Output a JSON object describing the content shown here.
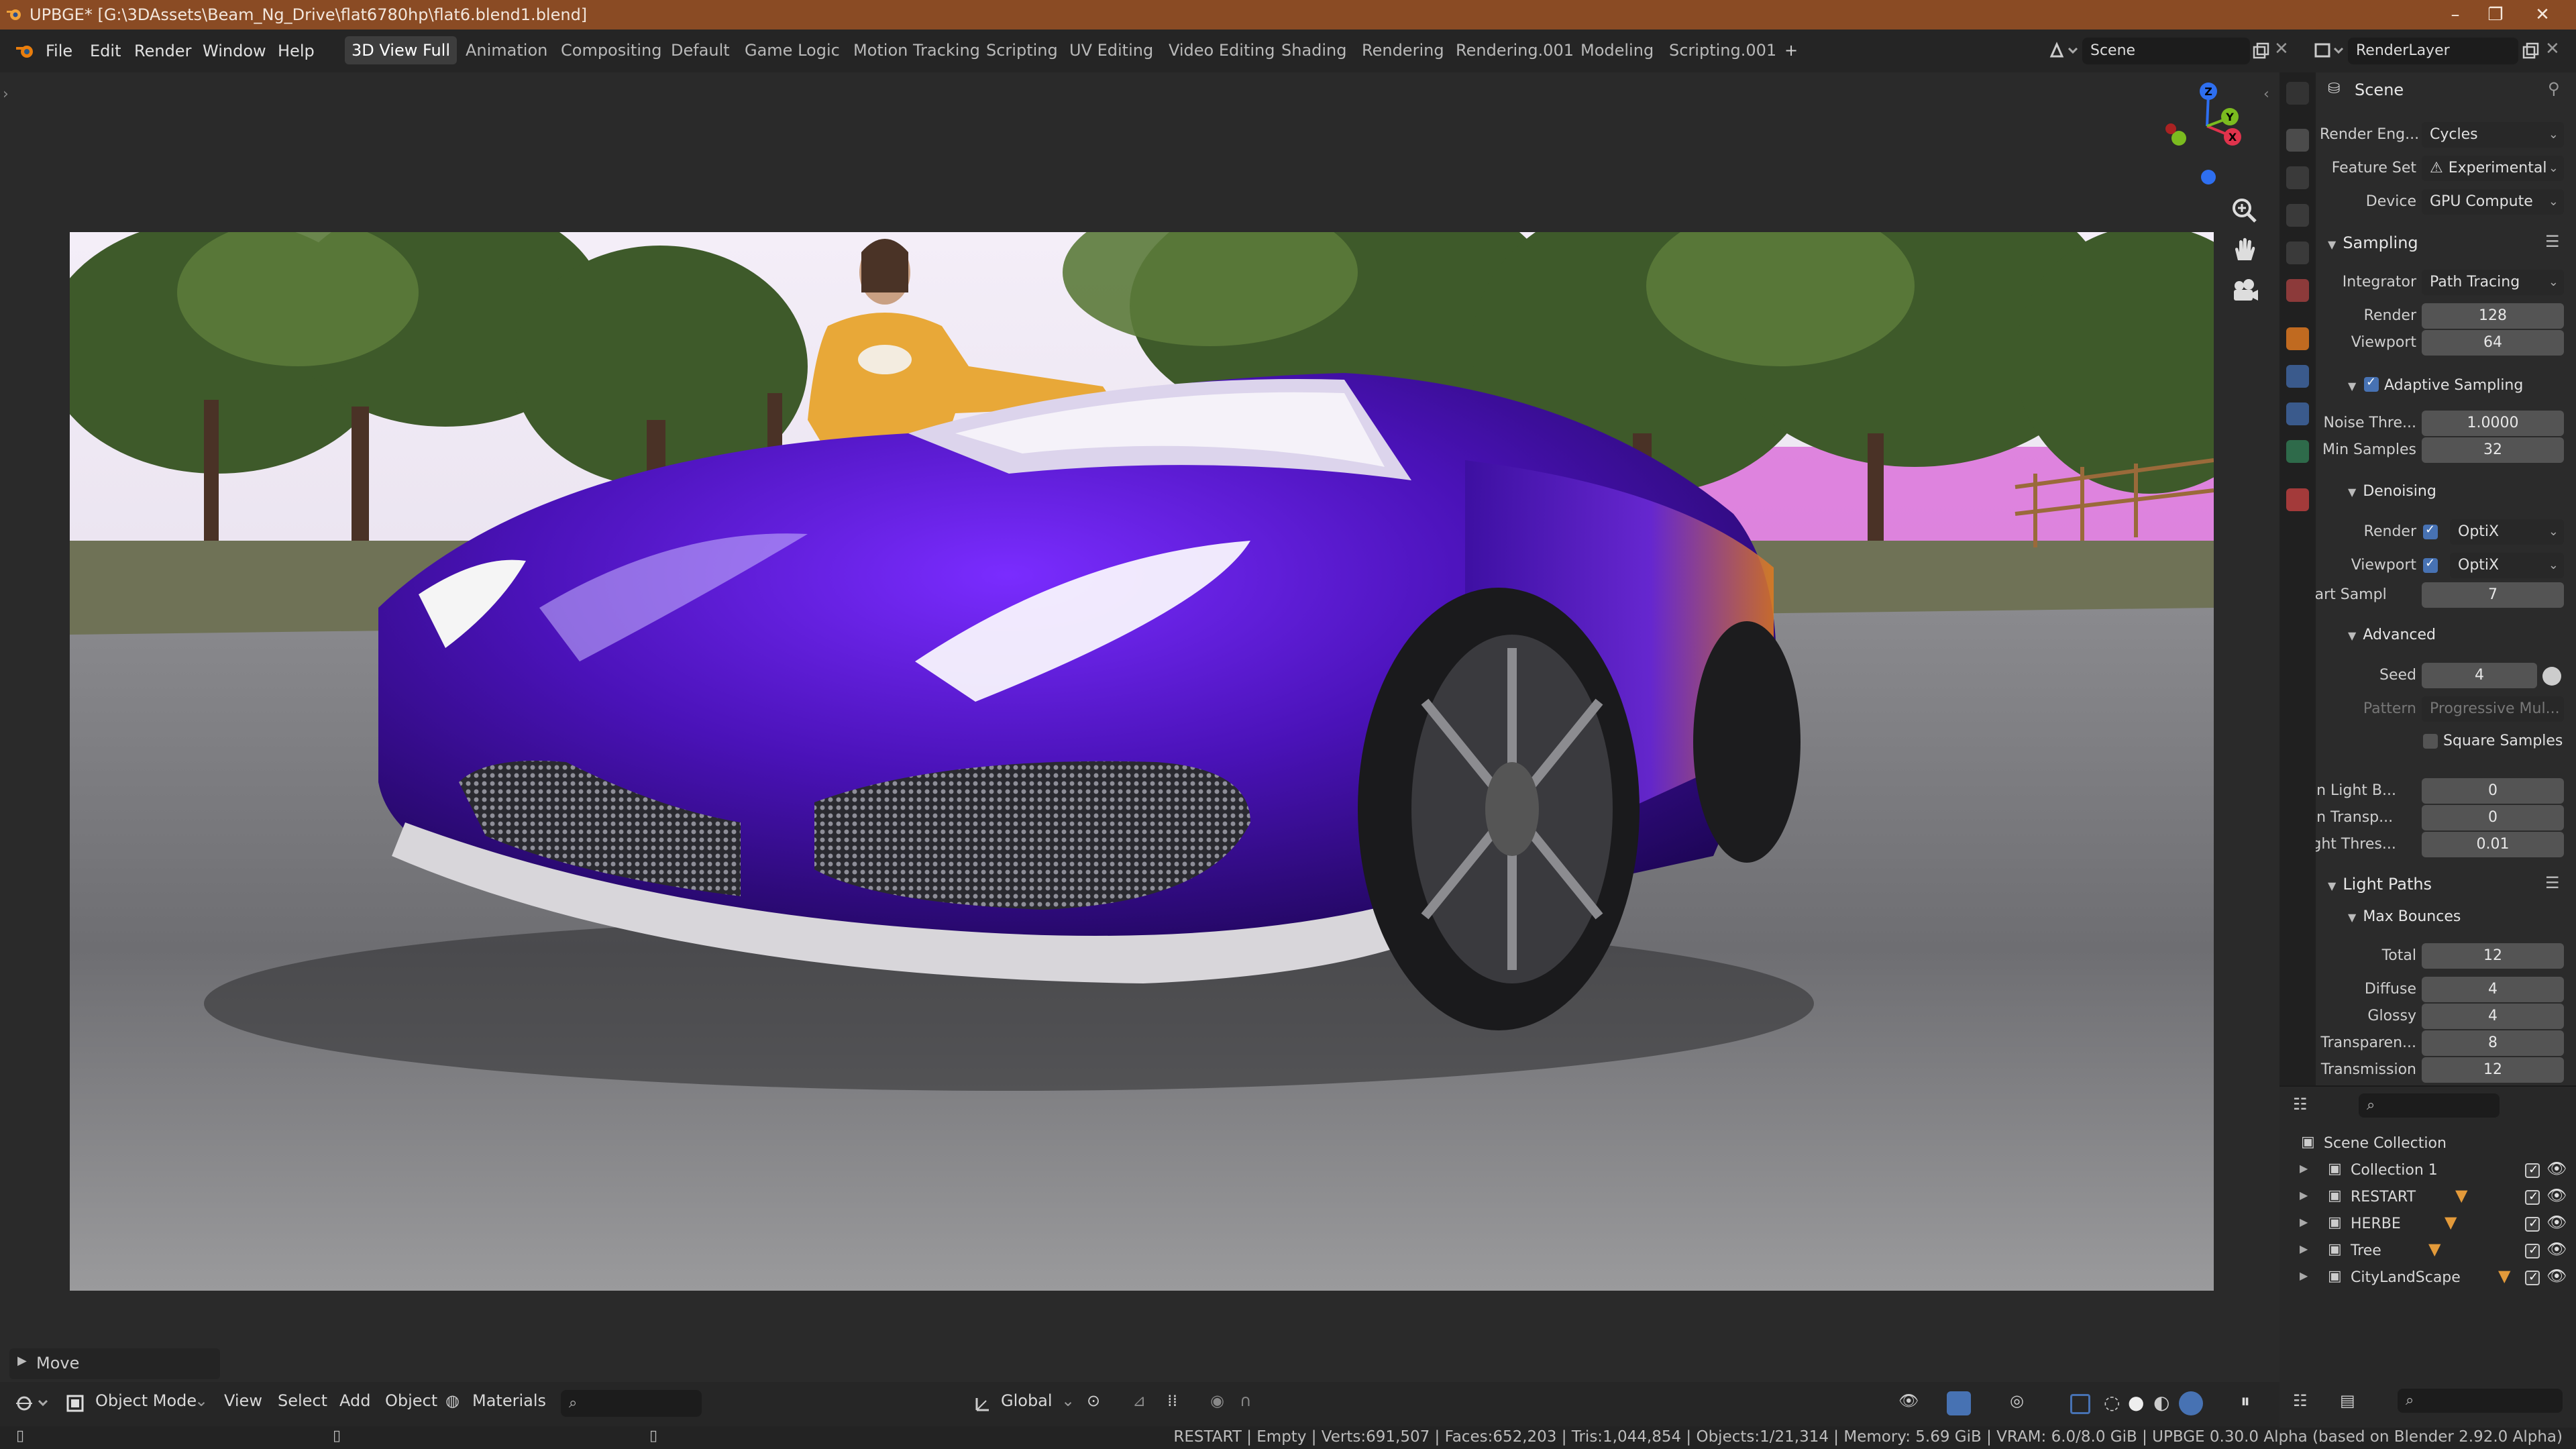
{
  "titlebar": {
    "title": "UPBGE* [G:\\3DAssets\\Beam_Ng_Drive\\flat6780hp\\flat6.blend1.blend]"
  },
  "menu": [
    "File",
    "Edit",
    "Render",
    "Window",
    "Help"
  ],
  "workspaces": [
    "3D View Full",
    "Animation",
    "Compositing",
    "Default",
    "Game Logic",
    "Motion Tracking",
    "Scripting",
    "UV Editing",
    "Video Editing",
    "Shading",
    "Rendering",
    "Rendering.001",
    "Modeling",
    "Scripting.001"
  ],
  "active_workspace": "3D View Full",
  "add_workspace": "+",
  "scene_selector": {
    "value": "Scene"
  },
  "view_layer_selector": {
    "value": "RenderLayer"
  },
  "viewport": {
    "last_operator": "Move",
    "gizmo": {
      "x": "X",
      "y": "Y",
      "z": "Z"
    }
  },
  "bottom_header": {
    "mode": "Object Mode",
    "menus": [
      "View",
      "Select",
      "Add",
      "Object"
    ],
    "materials": "Materials",
    "transform_orientation": "Global"
  },
  "status_bar": {
    "stats": "RESTART | Empty | Verts:691,507 | Faces:652,203 | Tris:1,044,854 | Objects:1/21,314 | Memory: 5.69 GiB | VRAM: 6.0/8.0 GiB | UPBGE 0.30.0 Alpha (based on Blender 2.92.0 Alpha)"
  },
  "properties": {
    "header": "Scene",
    "render_engine": {
      "label": "Render Eng...",
      "value": "Cycles"
    },
    "feature_set": {
      "label": "Feature Set",
      "value": "Experimental"
    },
    "device": {
      "label": "Device",
      "value": "GPU Compute"
    },
    "sampling": {
      "title": "Sampling",
      "integrator": {
        "label": "Integrator",
        "value": "Path Tracing"
      },
      "render": {
        "label": "Render",
        "value": "128"
      },
      "viewport": {
        "label": "Viewport",
        "value": "64"
      },
      "adaptive": {
        "label": "Adaptive Sampling",
        "checked": true
      },
      "noise_threshold": {
        "label": "Noise Thre...",
        "value": "1.0000"
      },
      "min_samples": {
        "label": "Min Samples",
        "value": "32"
      }
    },
    "denoising": {
      "title": "Denoising",
      "render": {
        "label": "Render",
        "value": "OptiX",
        "checked": true
      },
      "viewport": {
        "label": "Viewport",
        "value": "OptiX",
        "checked": true
      },
      "start_sample": {
        "label": "Start Sampl",
        "value": "7"
      }
    },
    "advanced": {
      "title": "Advanced",
      "seed": {
        "label": "Seed",
        "value": "4"
      },
      "pattern": {
        "label": "Pattern",
        "value": "Progressive Mul..."
      },
      "square_samples": {
        "label": "Square Samples",
        "checked": false
      },
      "min_light_bounces": {
        "label": "Min Light B...",
        "value": "0"
      },
      "min_transparent": {
        "label": "Min Transp...",
        "value": "0"
      },
      "light_threshold": {
        "label": "Light Thres...",
        "value": "0.01"
      }
    },
    "light_paths": {
      "title": "Light Paths",
      "max_bounces": "Max Bounces",
      "total": {
        "label": "Total",
        "value": "12"
      },
      "diffuse": {
        "label": "Diffuse",
        "value": "4"
      },
      "glossy": {
        "label": "Glossy",
        "value": "4"
      },
      "transparency": {
        "label": "Transparen...",
        "value": "8"
      },
      "transmission": {
        "label": "Transmission",
        "value": "12"
      }
    }
  },
  "outliner": {
    "root": "Scene Collection",
    "items": [
      "Collection 1",
      "RESTART",
      "HERBE",
      "Tree",
      "CityLandScape"
    ]
  },
  "colors": {
    "titlebar": "#8a4b24",
    "accent": "#4772b3",
    "car_paint": "#4a12b8"
  }
}
